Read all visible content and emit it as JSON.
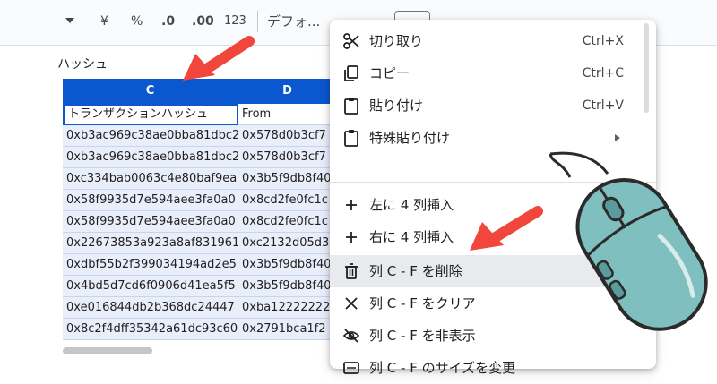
{
  "toolbar": {
    "yen": "¥",
    "percent": "%",
    "decrease_decimal": ".0",
    "increase_decimal": ".00",
    "number_format": "123",
    "font": "デフォ..."
  },
  "formula_bar": {
    "value": "ハッシュ"
  },
  "columns": [
    {
      "label": "C"
    },
    {
      "label": "D"
    }
  ],
  "rows": [
    {
      "c": "トランザクションハッシュ",
      "d": "From"
    },
    {
      "c": "0xb3ac969c38ae0bba81dbc2",
      "d": "0x578d0b3cf7"
    },
    {
      "c": "0xb3ac969c38ae0bba81dbc2",
      "d": "0x578d0b3cf7"
    },
    {
      "c": "0xc334bab0063c4e80baf9ea",
      "d": "0x3b5f9db8f40"
    },
    {
      "c": "0x58f9935d7e594aee3fa0a0",
      "d": "0x8cd2fe0fc1c"
    },
    {
      "c": "0x58f9935d7e594aee3fa0a0",
      "d": "0x8cd2fe0fc1c"
    },
    {
      "c": "0x22673853a923a8af831961",
      "d": "0xc2132d05d3"
    },
    {
      "c": "0xdbf55b2f399034194ad2e5",
      "d": "0x3b5f9db8f40"
    },
    {
      "c": "0x4bd5d7cd6f0906d41ea5f5",
      "d": "0x3b5f9db8f40"
    },
    {
      "c": "0xe016844db2b368dc24447",
      "d": "0xba12222222"
    },
    {
      "c": "0x8c2f4dff35342a61dc93c60",
      "d": "0x2791bca1f2"
    }
  ],
  "context_menu": {
    "items": [
      {
        "label": "切り取り",
        "shortcut": "Ctrl+X",
        "icon": "scissors-icon"
      },
      {
        "label": "コピー",
        "shortcut": "Ctrl+C",
        "icon": "copy-icon"
      },
      {
        "label": "貼り付け",
        "shortcut": "Ctrl+V",
        "icon": "clipboard-icon"
      },
      {
        "label": "特殊貼り付け",
        "shortcut": "",
        "icon": "clipboard-icon"
      },
      {
        "label": "左に 4 列挿入",
        "shortcut": "",
        "icon": "plus-icon"
      },
      {
        "label": "右に 4 列挿入",
        "shortcut": "",
        "icon": "plus-icon"
      },
      {
        "label": "列 C - F を削除",
        "shortcut": "",
        "icon": "trash-icon"
      },
      {
        "label": "列 C - F をクリア",
        "shortcut": "",
        "icon": "close-icon"
      },
      {
        "label": "列 C - F を非表示",
        "shortcut": "",
        "icon": "eye-off-icon"
      },
      {
        "label": "列 C - F のサイズを変更",
        "shortcut": "",
        "icon": "resize-icon"
      }
    ]
  },
  "colors": {
    "header_blue": "#0b57d0",
    "selection_fill": "#e8eefa",
    "arrow_red": "#f0463c",
    "mouse_teal": "#7fbfbf"
  }
}
